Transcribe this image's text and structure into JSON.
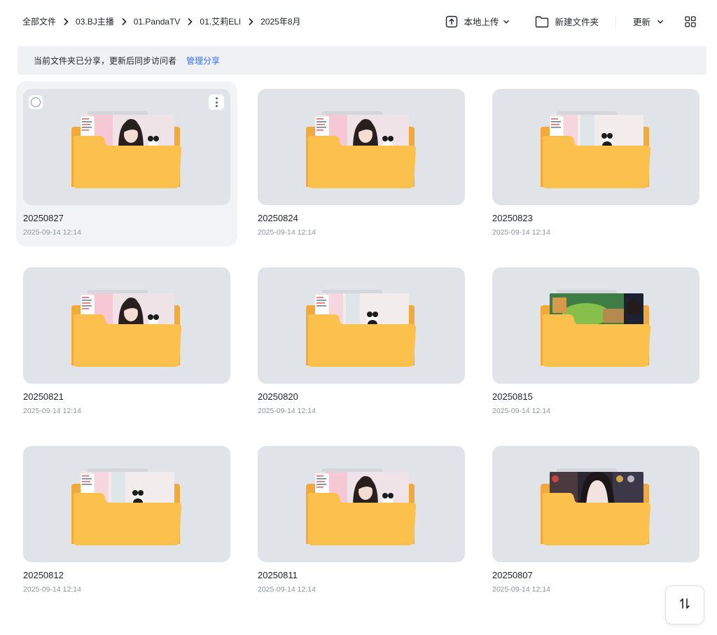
{
  "breadcrumb": [
    "全部文件",
    "03.BJ主播",
    "01.PandaTV",
    "01.艾莉ELI",
    "2025年8月"
  ],
  "toolbar": {
    "upload_label": "本地上传",
    "new_folder_label": "新建文件夹",
    "sort_label": "更新",
    "upload_icon": "upload-icon",
    "folder_icon": "folder-outline-icon",
    "view_icon": "grid-view-icon"
  },
  "banner": {
    "text": "当前文件夹已分享，更新后同步访问者",
    "link": "管理分享"
  },
  "folders": [
    {
      "name": "20250827",
      "date": "2025-09-14 12:14",
      "preview": "stream"
    },
    {
      "name": "20250824",
      "date": "2025-09-14 12:14",
      "preview": "stream"
    },
    {
      "name": "20250823",
      "date": "2025-09-14 12:14",
      "preview": "room"
    },
    {
      "name": "20250821",
      "date": "2025-09-14 12:14",
      "preview": "stream"
    },
    {
      "name": "20250820",
      "date": "2025-09-14 12:14",
      "preview": "room"
    },
    {
      "name": "20250815",
      "date": "2025-09-14 12:14",
      "preview": "game"
    },
    {
      "name": "20250812",
      "date": "2025-09-14 12:14",
      "preview": "room"
    },
    {
      "name": "20250811",
      "date": "2025-09-14 12:14",
      "preview": "stream"
    },
    {
      "name": "20250807",
      "date": "2025-09-14 12:14",
      "preview": "dark"
    }
  ],
  "colors": {
    "accent": "#3370ff",
    "folder": "#fcc14d",
    "folder_back": "#f0a93a",
    "thumb_bg": "#e0e4e9"
  },
  "sort_button_icon": "sort-toggle-icon"
}
